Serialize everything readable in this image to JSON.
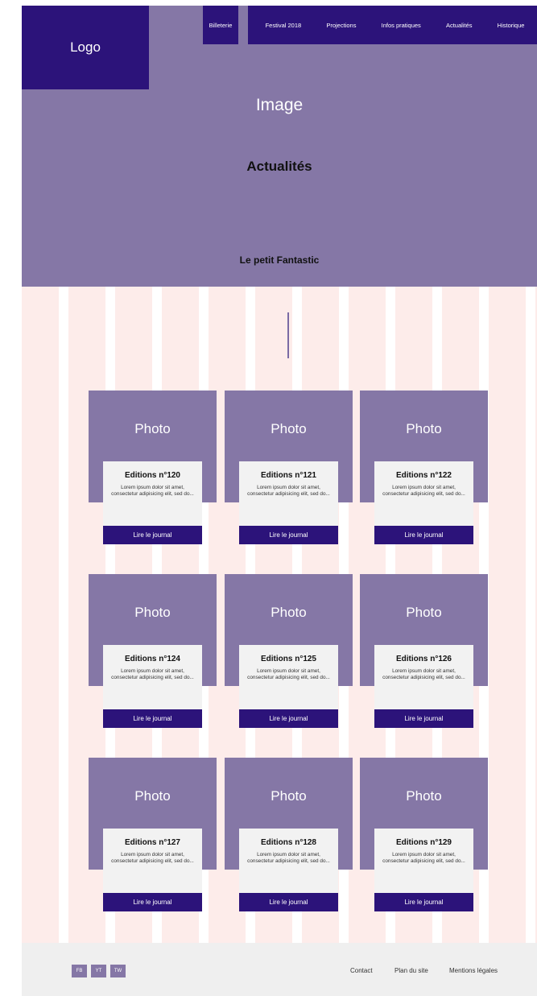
{
  "header": {
    "logo": "Logo",
    "nav": [
      "Billeterie",
      "Festival 2018",
      "Projections",
      "Infos pratiques",
      "Actualités",
      "Historique"
    ],
    "image_label": "Image",
    "title": "Actualités",
    "subtitle": "Le petit Fantastic"
  },
  "cards": [
    {
      "photo": "Photo",
      "title": "Editions n°120",
      "text": "Lorem ipsum dolor sit amet, consectetur adipisicing elit, sed do...",
      "button": "Lire le journal"
    },
    {
      "photo": "Photo",
      "title": "Editions n°121",
      "text": "Lorem ipsum dolor sit amet, consectetur adipisicing elit, sed do...",
      "button": "Lire le journal"
    },
    {
      "photo": "Photo",
      "title": "Editions n°122",
      "text": "Lorem ipsum dolor sit amet, consectetur adipisicing elit, sed do...",
      "button": "Lire le journal"
    },
    {
      "photo": "Photo",
      "title": "Editions n°124",
      "text": "Lorem ipsum dolor sit amet, consectetur adipisicing elit, sed do...",
      "button": "Lire le journal"
    },
    {
      "photo": "Photo",
      "title": "Editions n°125",
      "text": "Lorem ipsum dolor sit amet, consectetur adipisicing elit, sed do...",
      "button": "Lire le journal"
    },
    {
      "photo": "Photo",
      "title": "Editions n°126",
      "text": "Lorem ipsum dolor sit amet, consectetur adipisicing elit, sed do...",
      "button": "Lire le journal"
    },
    {
      "photo": "Photo",
      "title": "Editions n°127",
      "text": "Lorem ipsum dolor sit amet, consectetur adipisicing elit, sed do...",
      "button": "Lire le journal"
    },
    {
      "photo": "Photo",
      "title": "Editions n°128",
      "text": "Lorem ipsum dolor sit amet, consectetur adipisicing elit, sed do...",
      "button": "Lire le journal"
    },
    {
      "photo": "Photo",
      "title": "Editions n°129",
      "text": "Lorem ipsum dolor sit amet, consectetur adipisicing elit, sed do...",
      "button": "Lire le journal"
    }
  ],
  "footer": {
    "social": [
      "FB",
      "YT",
      "TW"
    ],
    "links": [
      "Contact",
      "Plan du site",
      "Mentions légales"
    ]
  },
  "colors": {
    "primary": "#2c137a",
    "secondary": "#8577a6",
    "stripe": "#fdecea",
    "footer_bg": "#efefef"
  }
}
